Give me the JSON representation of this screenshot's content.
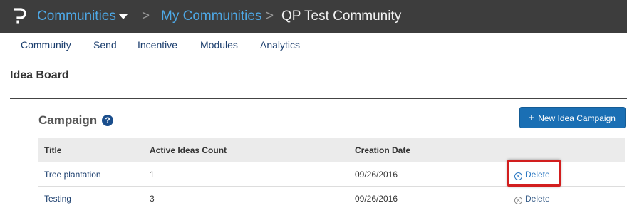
{
  "header": {
    "logo_icon": "p-logo-icon",
    "communities_label": "Communities",
    "dropdown_icon": "caret-down-icon",
    "separator": ">",
    "my_communities_label": "My Communities",
    "current_label": "QP Test Community"
  },
  "subnav": {
    "items": [
      {
        "label": "Community"
      },
      {
        "label": "Send"
      },
      {
        "label": "Incentive"
      },
      {
        "label": "Modules",
        "active": true
      },
      {
        "label": "Analytics"
      }
    ]
  },
  "page": {
    "title": "Idea Board"
  },
  "campaign": {
    "title": "Campaign",
    "help_glyph": "?",
    "new_button_label": "New Idea Campaign",
    "columns": [
      "Title",
      "Active Ideas Count",
      "Creation Date"
    ],
    "rows": [
      {
        "title": "Tree plantation",
        "count": "1",
        "date": "09/26/2016",
        "action": "Delete"
      },
      {
        "title": "Testing",
        "count": "3",
        "date": "09/26/2016",
        "action": "Delete"
      }
    ]
  },
  "colors": {
    "topbar": "#3d3d3d",
    "link": "#4ea8e6",
    "primary_button": "#1a6fb4",
    "highlight": "#d21e1e"
  }
}
